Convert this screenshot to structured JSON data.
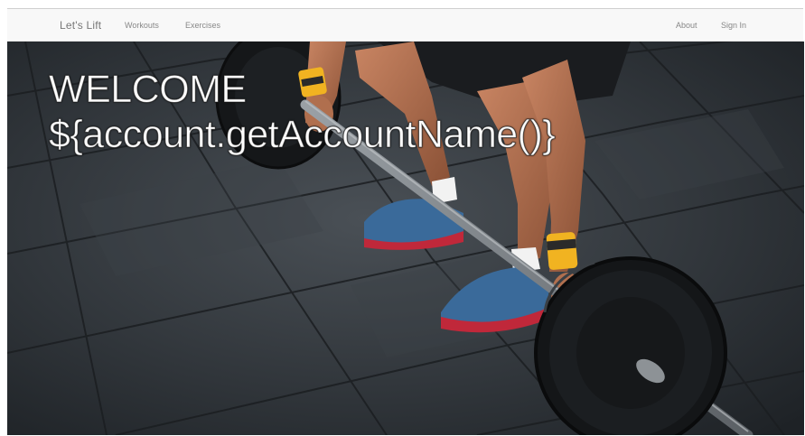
{
  "navbar": {
    "brand": "Let's Lift",
    "left_links": [
      "Workouts",
      "Exercises"
    ],
    "right_links": [
      "About",
      "Sign In"
    ]
  },
  "hero": {
    "title_line1": "WELCOME",
    "title_line2": "${account.getAccountName()}",
    "image_description_icon": "deadlift-photo"
  },
  "colors": {
    "navbar_bg": "#f8f8f8",
    "nav_text": "#777777",
    "hero_text": "#ffffff",
    "floor_dark": "#2b2f33",
    "shoe_blue": "#3a6a9a",
    "wrist_wrap_yellow": "#f1b321"
  }
}
